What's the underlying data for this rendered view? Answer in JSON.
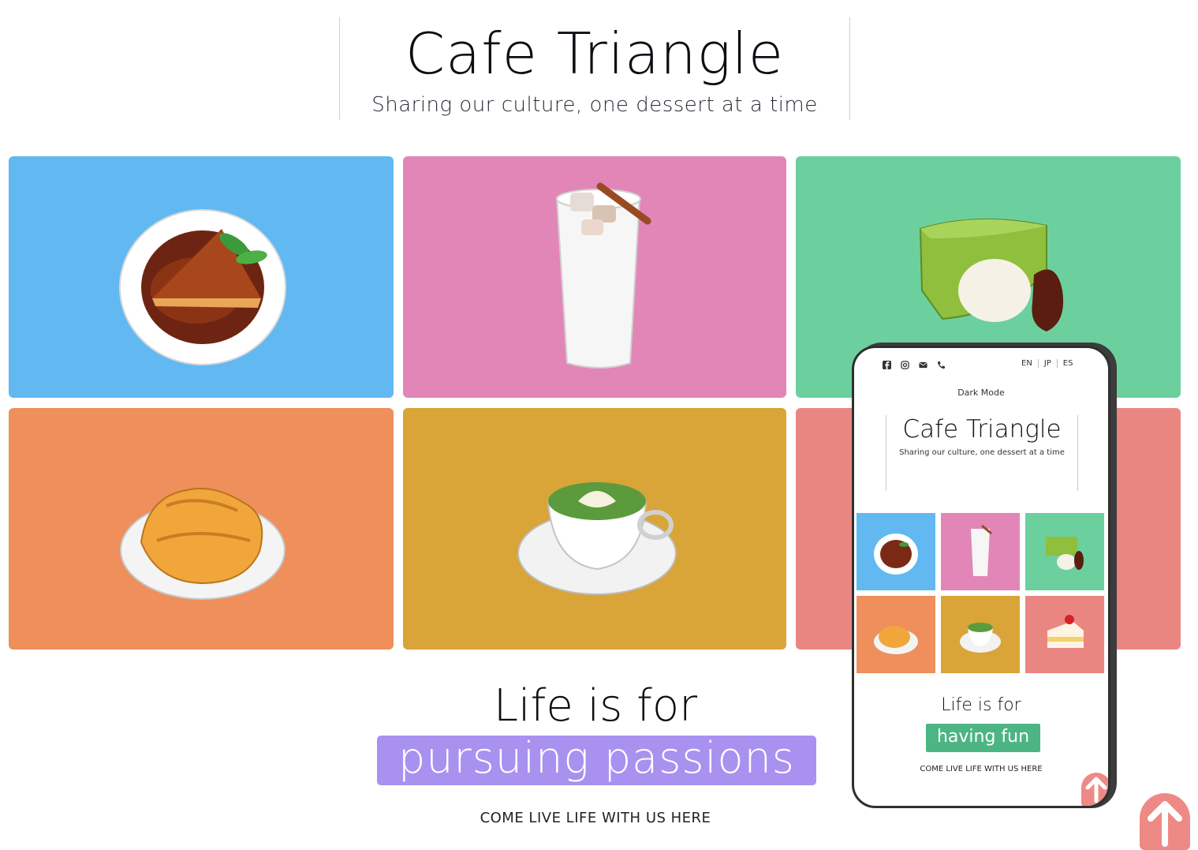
{
  "header": {
    "title": "Cafe Triangle",
    "subtitle": "Sharing our culture, one dessert at a time"
  },
  "tiles": [
    {
      "dessert": "caramel pie",
      "color": "#62b9f2"
    },
    {
      "dessert": "iced milk drink",
      "color": "#e286b8"
    },
    {
      "dessert": "matcha cake",
      "color": "#6bd09e"
    },
    {
      "dessert": "taiyaki",
      "color": "#ee8f5c"
    },
    {
      "dessert": "matcha latte",
      "color": "#d9a438"
    },
    {
      "dessert": "strawberry cake",
      "color": "#ea8682"
    }
  ],
  "tagline": {
    "lead": "Life is for",
    "highlight": "pursuing passions",
    "highlight_color": "#a991f0",
    "cta": "COME LIVE LIFE WITH US HERE"
  },
  "phone": {
    "social_icons": [
      "facebook-icon",
      "instagram-icon",
      "mail-icon",
      "phone-icon"
    ],
    "languages": [
      "EN",
      "JP",
      "ES"
    ],
    "dark_mode": "Dark Mode",
    "title": "Cafe Triangle",
    "subtitle": "Sharing our culture, one dessert at a time",
    "lead": "Life is for",
    "highlight": "having fun",
    "highlight_color": "#4cb583",
    "cta": "COME LIVE LIFE WITH US HERE"
  },
  "scroll_top_icon": "arrow-up-icon",
  "accent_color": "#ee8a86"
}
